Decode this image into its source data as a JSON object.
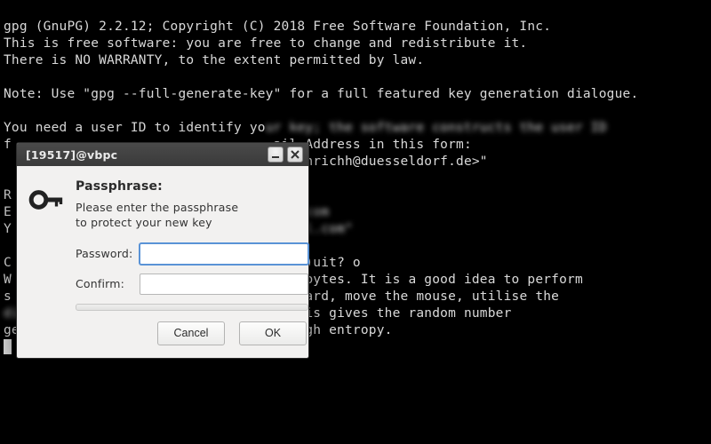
{
  "terminal": {
    "line1": "gpg (GnuPG) 2.2.12; Copyright (C) 2018 Free Software Foundation, Inc.",
    "line2": "This is free software: you are free to change and redistribute it.",
    "line3": "There is NO WARRANTY, to the extent permitted by law.",
    "line4": "",
    "line5": "Note: Use \"gpg --full-generate-key\" for a full featured key generation dialogue.",
    "line6": "",
    "line7a": "You need a user ID to identify yo",
    "line7b": "ur key; the software constructs the user ID",
    "line8a": "f",
    "line8b": "ail Address in this form:",
    "line9": "<heinrichh@duesseldorf.de>\"",
    "line10": "",
    "line11": "R",
    "line12a": "E",
    "line12b": ".2.com",
    "line13a": "Y",
    "line13b": "gail.com\"",
    "line14": "",
    "line15a": "C",
    "line15b": "/(Q)uit? o",
    "line16a": "W",
    "line16b": "om bytes. It is a good idea to perform",
    "line17a": "s",
    "line17b": "yboard, move the mouse, utilise the",
    "line18a": "disks) during the prime generation",
    "line18b": "; this gives the random number",
    "line19": "generator a better chance to gain enough entropy."
  },
  "dialog": {
    "title": "[19517]@vbpc",
    "icon": "key-icon",
    "heading": "Passphrase:",
    "subtext": "Please enter the passphrase to protect your new key",
    "password_label": "Password:",
    "confirm_label": "Confirm:",
    "password_value": "",
    "confirm_value": "",
    "cancel_label": "Cancel",
    "ok_label": "OK"
  }
}
